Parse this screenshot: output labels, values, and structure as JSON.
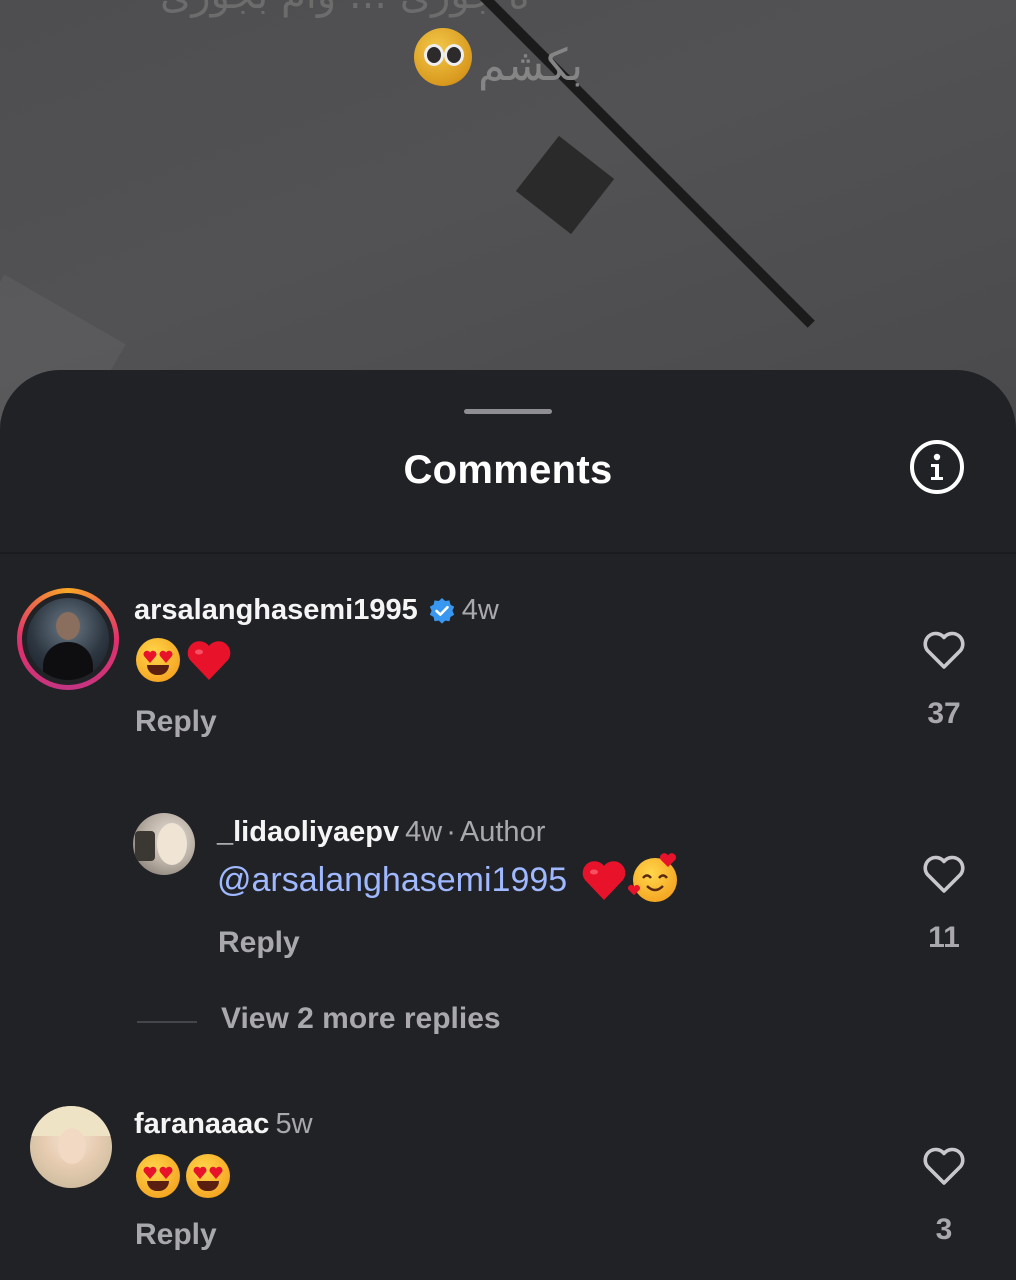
{
  "background": {
    "overlay_text": "بکشم",
    "overlay_text_top": "ه جوری ... وام بجوری"
  },
  "sheet": {
    "title": "Comments",
    "info_icon": "info-circle-icon"
  },
  "comments": [
    {
      "username": "arsalanghasemi1995",
      "verified": true,
      "time": "4w",
      "emojis": [
        "heart-eyes-emoji",
        "red-heart-emoji"
      ],
      "reply_label": "Reply",
      "likes": "37",
      "story_ring": true
    },
    {
      "username": "_lidaoliyaepv",
      "time": "4w",
      "separator": "·",
      "badge": "Author",
      "mention": "@arsalanghasemi1995",
      "emojis": [
        "red-heart-emoji",
        "smiling-face-with-hearts-emoji"
      ],
      "reply_label": "Reply",
      "likes": "11"
    },
    {
      "username": "faranaaac",
      "time": "5w",
      "emojis": [
        "heart-eyes-emoji",
        "heart-eyes-emoji"
      ],
      "reply_label": "Reply",
      "likes": "3"
    }
  ],
  "view_more_replies": "View 2 more replies",
  "colors": {
    "sheet_bg": "#212226",
    "text_primary": "#f5f5f5",
    "text_secondary": "#a8a8ad",
    "mention": "#9fb8ff",
    "verified": "#3897f0"
  }
}
